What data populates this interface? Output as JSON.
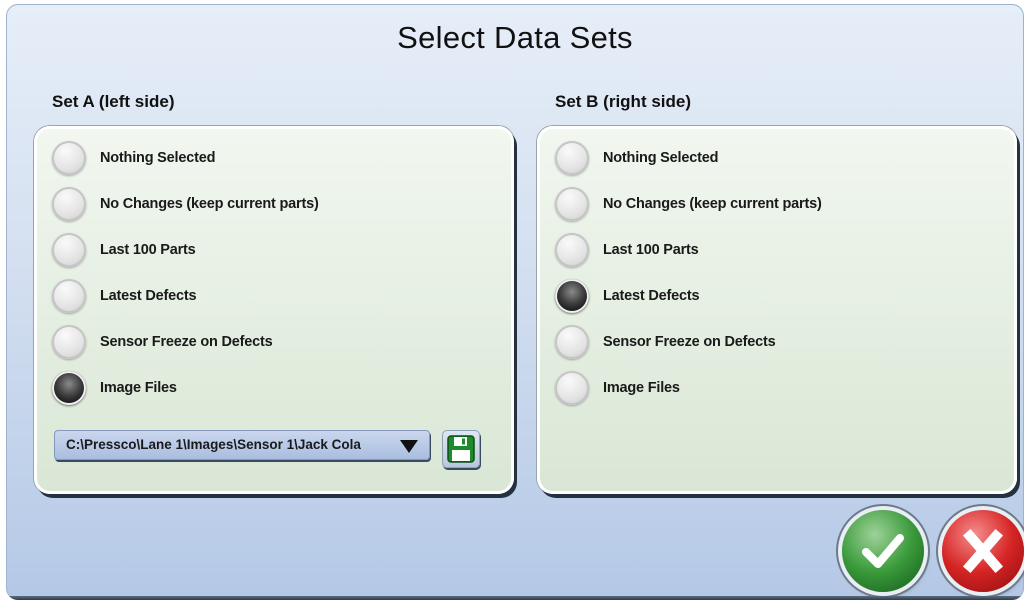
{
  "dialog": {
    "title": "Select Data Sets"
  },
  "set_a": {
    "label": "Set A (left side)",
    "options": [
      {
        "label": "Nothing Selected",
        "selected": false
      },
      {
        "label": "No Changes (keep current parts)",
        "selected": false
      },
      {
        "label": "Last 100 Parts",
        "selected": false
      },
      {
        "label": "Latest Defects",
        "selected": false
      },
      {
        "label": "Sensor Freeze on Defects",
        "selected": false
      },
      {
        "label": "Image Files",
        "selected": true
      }
    ],
    "path_select": {
      "value": "C:\\Pressco\\Lane 1\\Images\\Sensor 1\\Jack Cola"
    },
    "save_icon": "floppy-disk-icon"
  },
  "set_b": {
    "label": "Set B (right side)",
    "options": [
      {
        "label": "Nothing Selected",
        "selected": false
      },
      {
        "label": "No Changes (keep current parts)",
        "selected": false
      },
      {
        "label": "Last 100 Parts",
        "selected": false
      },
      {
        "label": "Latest Defects",
        "selected": true
      },
      {
        "label": "Sensor Freeze on Defects",
        "selected": false
      },
      {
        "label": "Image Files",
        "selected": false
      }
    ]
  },
  "actions": {
    "ok_icon": "checkmark-icon",
    "cancel_icon": "x-icon"
  },
  "colors": {
    "ok_green": "#2f8f33",
    "cancel_red": "#d62424",
    "panel_green": "#e5efe2",
    "dialog_blue": "#c9d8ee"
  }
}
